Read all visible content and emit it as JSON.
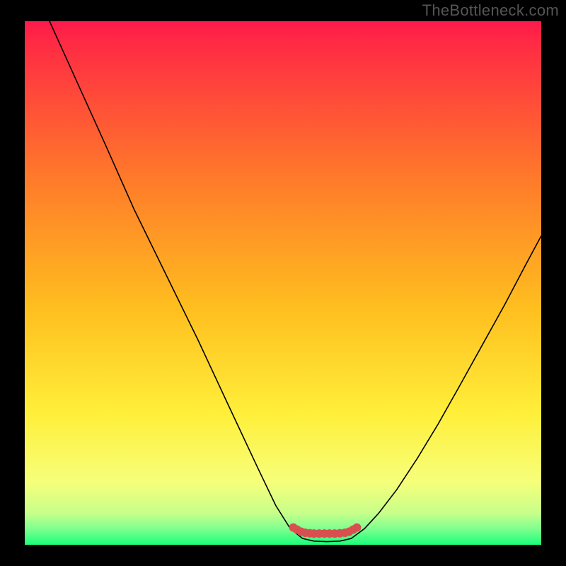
{
  "watermark": "TheBottleneck.com",
  "gradient": {
    "stops": [
      {
        "offset": 0.0,
        "color": "#ff1a4b"
      },
      {
        "offset": 0.04,
        "color": "#ff2a44"
      },
      {
        "offset": 0.3,
        "color": "#ff7a2a"
      },
      {
        "offset": 0.55,
        "color": "#ffbf1f"
      },
      {
        "offset": 0.75,
        "color": "#ffef3a"
      },
      {
        "offset": 0.88,
        "color": "#f6ff7a"
      },
      {
        "offset": 0.94,
        "color": "#c7ff8a"
      },
      {
        "offset": 0.97,
        "color": "#7dff8f"
      },
      {
        "offset": 1.0,
        "color": "#1aff7a"
      }
    ]
  },
  "chart_data": {
    "type": "line",
    "title": "",
    "xlabel": "",
    "ylabel": "",
    "x_range": [
      0,
      100
    ],
    "y_range": [
      0,
      100
    ],
    "series": [
      {
        "name": "bottleneck-curve",
        "color": "#000000",
        "width": 1.6,
        "points": [
          {
            "x": 4.8,
            "y": 100.0
          },
          {
            "x": 10.3,
            "y": 88.0
          },
          {
            "x": 15.8,
            "y": 76.0
          },
          {
            "x": 21.2,
            "y": 64.0
          },
          {
            "x": 27.4,
            "y": 51.5
          },
          {
            "x": 33.6,
            "y": 39.0
          },
          {
            "x": 39.5,
            "y": 26.5
          },
          {
            "x": 45.2,
            "y": 14.5
          },
          {
            "x": 48.6,
            "y": 7.5
          },
          {
            "x": 51.4,
            "y": 3.1
          },
          {
            "x": 53.8,
            "y": 1.2
          },
          {
            "x": 56.0,
            "y": 0.7
          },
          {
            "x": 58.5,
            "y": 0.6
          },
          {
            "x": 61.0,
            "y": 0.7
          },
          {
            "x": 63.2,
            "y": 1.2
          },
          {
            "x": 65.8,
            "y": 3.1
          },
          {
            "x": 68.5,
            "y": 6.0
          },
          {
            "x": 72.0,
            "y": 10.5
          },
          {
            "x": 76.0,
            "y": 16.5
          },
          {
            "x": 80.0,
            "y": 23.0
          },
          {
            "x": 84.0,
            "y": 30.0
          },
          {
            "x": 88.5,
            "y": 38.0
          },
          {
            "x": 93.0,
            "y": 46.0
          },
          {
            "x": 97.0,
            "y": 53.5
          },
          {
            "x": 100.0,
            "y": 59.0
          }
        ]
      },
      {
        "name": "sweet-spot-marker",
        "color": "#d94f4f",
        "width": 6,
        "points": [
          {
            "x": 52.0,
            "y": 3.3
          },
          {
            "x": 52.7,
            "y": 2.9
          },
          {
            "x": 53.5,
            "y": 2.5
          },
          {
            "x": 54.3,
            "y": 2.3
          },
          {
            "x": 55.2,
            "y": 2.2
          },
          {
            "x": 56.0,
            "y": 2.15
          },
          {
            "x": 57.0,
            "y": 2.15
          },
          {
            "x": 58.0,
            "y": 2.15
          },
          {
            "x": 59.0,
            "y": 2.15
          },
          {
            "x": 60.0,
            "y": 2.15
          },
          {
            "x": 61.0,
            "y": 2.2
          },
          {
            "x": 62.0,
            "y": 2.3
          },
          {
            "x": 62.8,
            "y": 2.5
          },
          {
            "x": 63.6,
            "y": 2.9
          },
          {
            "x": 64.3,
            "y": 3.3
          }
        ]
      }
    ]
  }
}
